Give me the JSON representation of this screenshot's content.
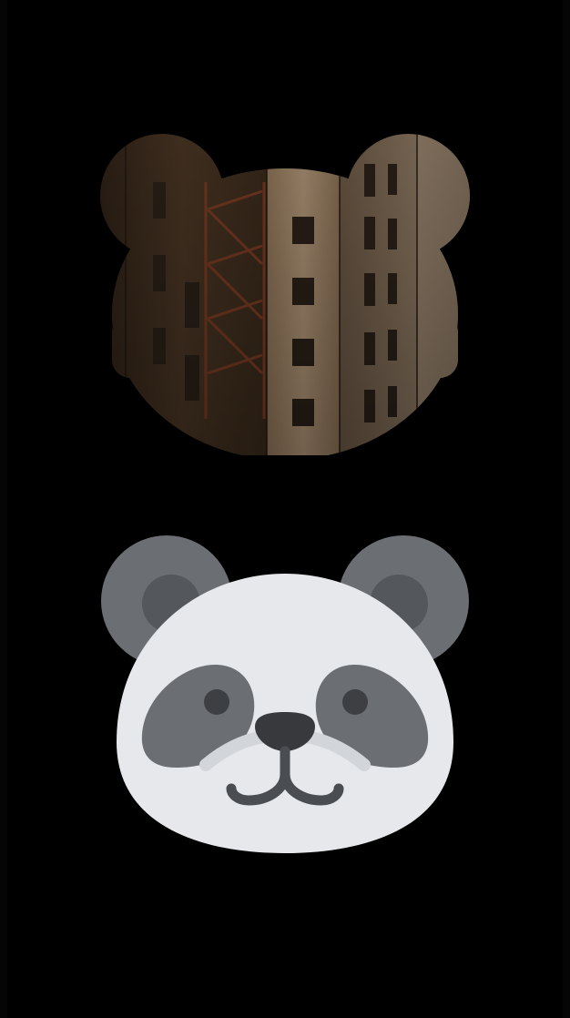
{
  "screen": {
    "background_color": "#000000"
  },
  "masked_image": {
    "shape": "bear-head",
    "content": "city-buildings-photo",
    "colors": {
      "left_building": "#4a3624",
      "middle_building": "#a4896a",
      "right_building": "#7d6a55",
      "windows": "#2b2118",
      "fire_escape": "#7a3b22"
    }
  },
  "panda_icon": {
    "colors": {
      "ears": "#6b6e73",
      "inner_ears": "#54575c",
      "face": "#e6e8eb",
      "eye_patches": "#6b6e73",
      "eyes": "#3d3f43",
      "nose": "#37393d",
      "muzzle_line": "#d2d5d9",
      "mouth": "#4a4d52"
    }
  }
}
